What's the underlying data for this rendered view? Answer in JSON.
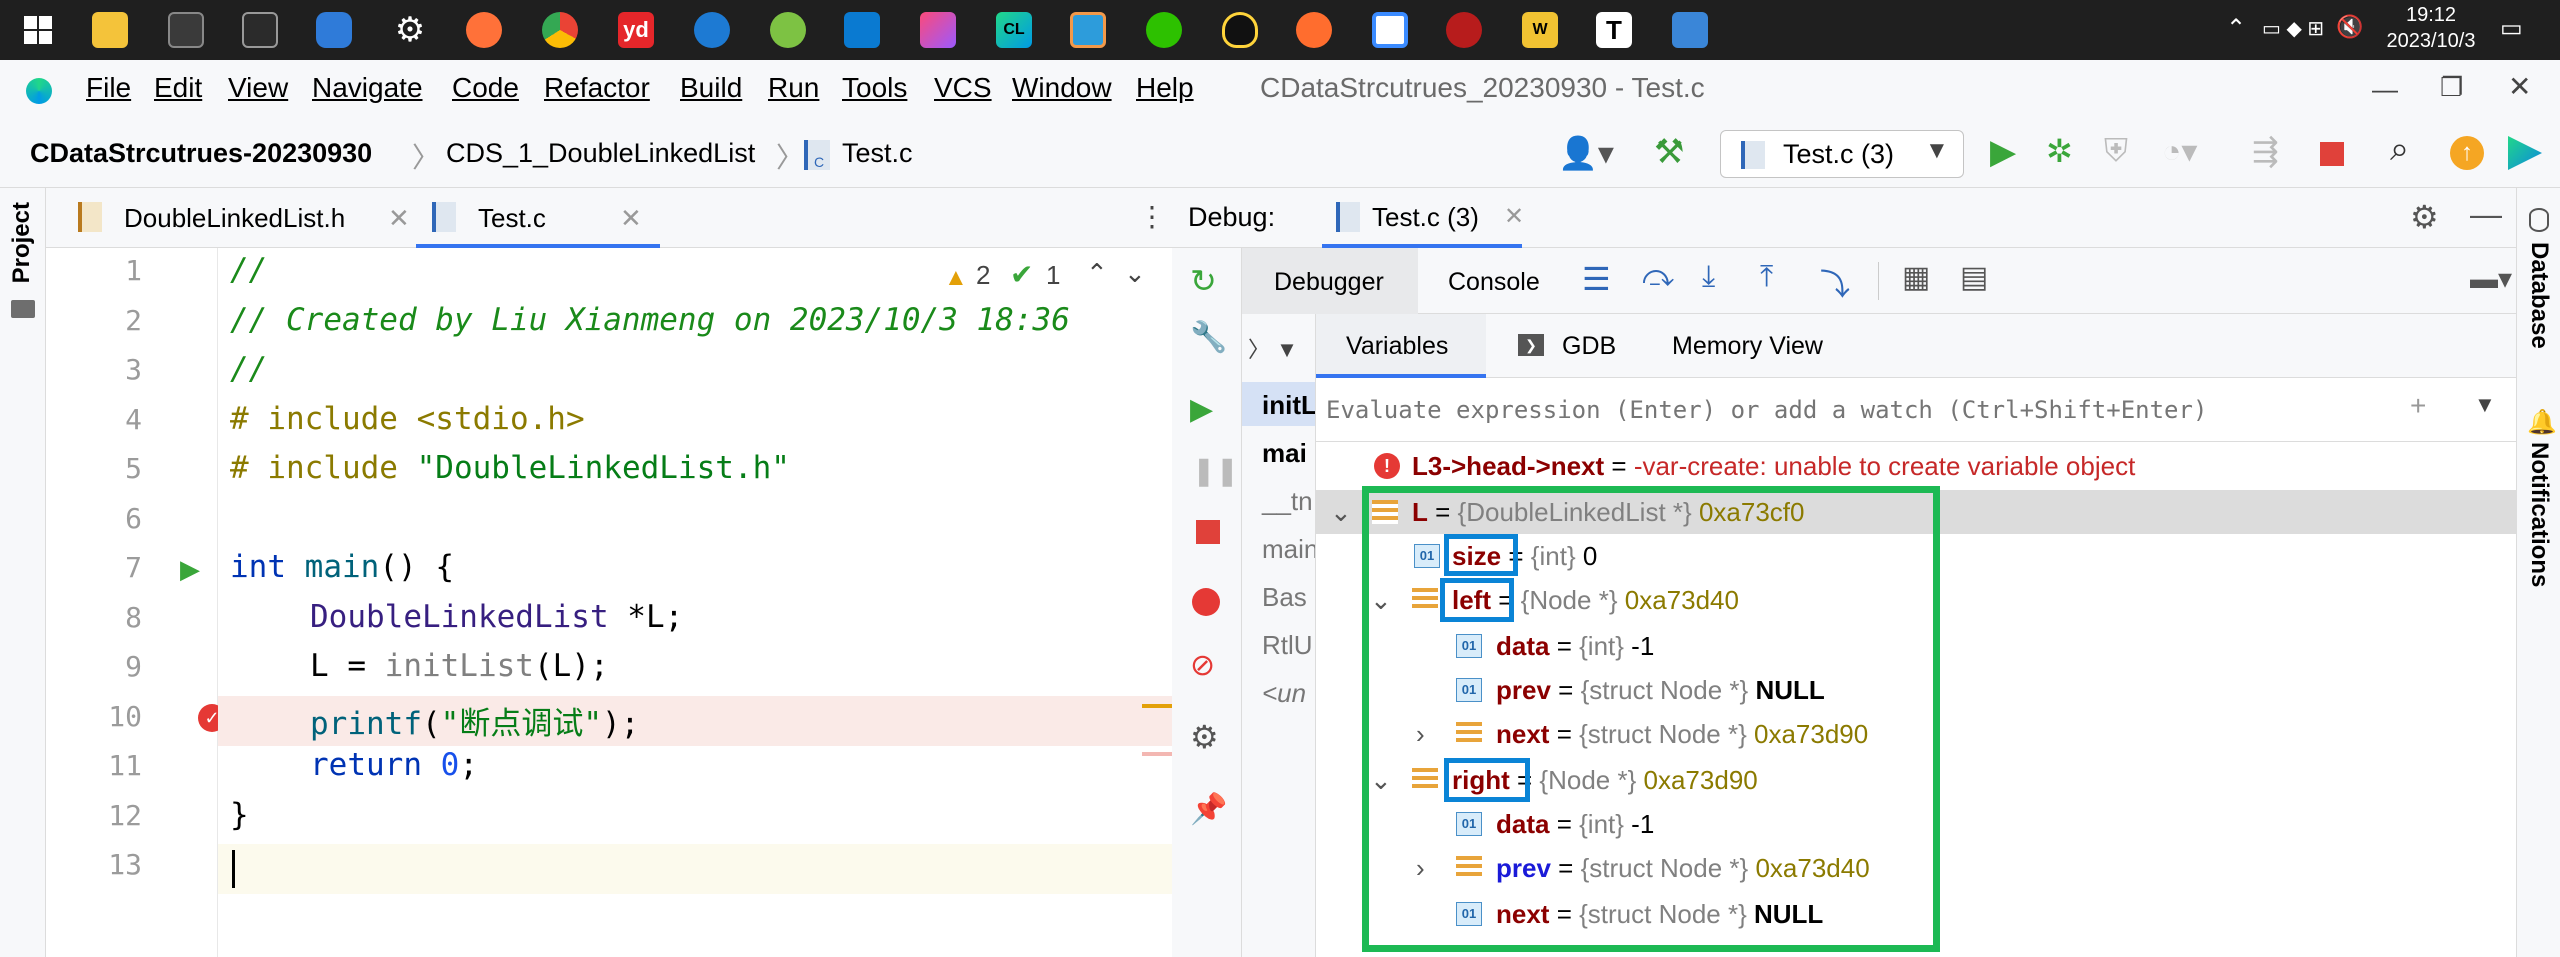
{
  "taskbar": {
    "time": "19:12",
    "date": "2023/10/3",
    "apps": [
      "start",
      "explorer",
      "terminal",
      "powershell",
      "dictionary",
      "settings",
      "firefox",
      "chrome",
      "youdao",
      "sourcetree",
      "git",
      "vscode",
      "toolbox",
      "clion",
      "screenshot",
      "wechat",
      "qq",
      "paint",
      "cloud",
      "shield",
      "wps",
      "typora",
      "remote"
    ]
  },
  "menu": {
    "items": [
      "File",
      "Edit",
      "View",
      "Navigate",
      "Code",
      "Refactor",
      "Build",
      "Run",
      "Tools",
      "VCS",
      "Window",
      "Help"
    ],
    "window_title": "CDataStrcutrues_20230930 - Test.c"
  },
  "breadcrumb": {
    "project": "CDataStrcutrues-20230930",
    "module": "CDS_1_DoubleLinkedList",
    "file": "Test.c",
    "run_config": "Test.c (3)"
  },
  "editor": {
    "tabs": [
      {
        "label": "DoubleLinkedList.h",
        "icon": "H"
      },
      {
        "label": "Test.c",
        "icon": "C",
        "active": true
      }
    ],
    "warnings": "2",
    "ok_count": "1",
    "lines": [
      "1",
      "2",
      "3",
      "4",
      "5",
      "6",
      "7",
      "8",
      "9",
      "10",
      "11",
      "12",
      "13"
    ],
    "code": {
      "l1": "//",
      "l2": "// Created by Liu Xianmeng on 2023/10/3 18:36",
      "l3": "//",
      "l4_kw": "# include",
      "l4_rest": " <stdio.h>",
      "l5_kw": "# include",
      "l5_rest": " \"DoubleLinkedList.h\"",
      "l7_kw": "int",
      "l7_fn": " main",
      "l7_rest": "() {",
      "l8_type": "DoubleLinkedList",
      "l8_rest": " *L;",
      "l9_pre": "L = ",
      "l9_fn": "initList",
      "l9_rest": "(L);",
      "l10_fn": "printf",
      "l10_open": "(",
      "l10_str": "\"断点调试\"",
      "l10_close": ");",
      "l11_kw": "return",
      "l11_num": " 0",
      "l11_rest": ";",
      "l12": "}"
    }
  },
  "debug": {
    "label": "Debug:",
    "session_tab": "Test.c (3)",
    "tabs": {
      "debugger": "Debugger",
      "console": "Console"
    },
    "var_tabs": {
      "variables": "Variables",
      "gdb": "GDB",
      "memory": "Memory View"
    },
    "eval_placeholder": "Evaluate expression (Enter) or add a watch (Ctrl+Shift+Enter)",
    "frames": [
      "initL",
      "mai",
      "__tn",
      "main",
      "Bas",
      "RtlU",
      "<un"
    ],
    "error": {
      "name": "L3->head->next",
      "eq": " = ",
      "msg": "-var-create: unable to create variable object"
    },
    "vars": [
      {
        "name": "L",
        "type": "{DoubleLinkedList *}",
        "value": "0xa73cf0"
      },
      {
        "name": "size",
        "type": "{int}",
        "value": "0"
      },
      {
        "name": "left",
        "type": "{Node *}",
        "value": "0xa73d40"
      },
      {
        "name": "data",
        "type": "{int}",
        "value": "-1"
      },
      {
        "name": "prev",
        "type": "{struct Node *}",
        "value": "NULL"
      },
      {
        "name": "next",
        "type": "{struct Node *}",
        "value": "0xa73d90"
      },
      {
        "name": "right",
        "type": "{Node *}",
        "value": "0xa73d90"
      },
      {
        "name": "data",
        "type": "{int}",
        "value": "-1"
      },
      {
        "name": "prev",
        "type": "{struct Node *}",
        "value": "0xa73d40"
      },
      {
        "name": "next",
        "type": "{struct Node *}",
        "value": "NULL"
      }
    ],
    "field_icon": "01"
  },
  "side": {
    "project": "Project",
    "database": "Database",
    "notifications": "Notifications"
  },
  "colors": {
    "highlight_green": "#1db954",
    "highlight_blue": "#0a84d6",
    "breakpoint": "#e53935"
  }
}
